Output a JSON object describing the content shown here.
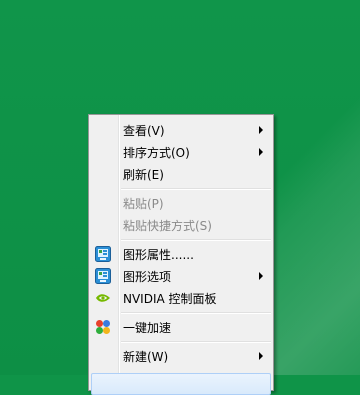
{
  "context_menu": {
    "items": [
      {
        "label": "查看(V)",
        "submenu": true,
        "disabled": false
      },
      {
        "label": "排序方式(O)",
        "submenu": true,
        "disabled": false
      },
      {
        "label": "刷新(E)",
        "submenu": false,
        "disabled": false
      },
      {
        "label": "粘贴(P)",
        "submenu": false,
        "disabled": true
      },
      {
        "label": "粘贴快捷方式(S)",
        "submenu": false,
        "disabled": true
      },
      {
        "label": "图形属性......",
        "submenu": false,
        "disabled": false,
        "icon": "intel-graphics-icon"
      },
      {
        "label": "图形选项",
        "submenu": true,
        "disabled": false,
        "icon": "intel-graphics-icon"
      },
      {
        "label": "NVIDIA 控制面板",
        "submenu": false,
        "disabled": false,
        "icon": "nvidia-icon"
      },
      {
        "label": "一键加速",
        "submenu": false,
        "disabled": false,
        "icon": "speedup-icon"
      },
      {
        "label": "新建(W)",
        "submenu": true,
        "disabled": false
      }
    ]
  },
  "colors": {
    "desktop_green": "#0f9448",
    "menu_bg": "#f0f0f0"
  }
}
